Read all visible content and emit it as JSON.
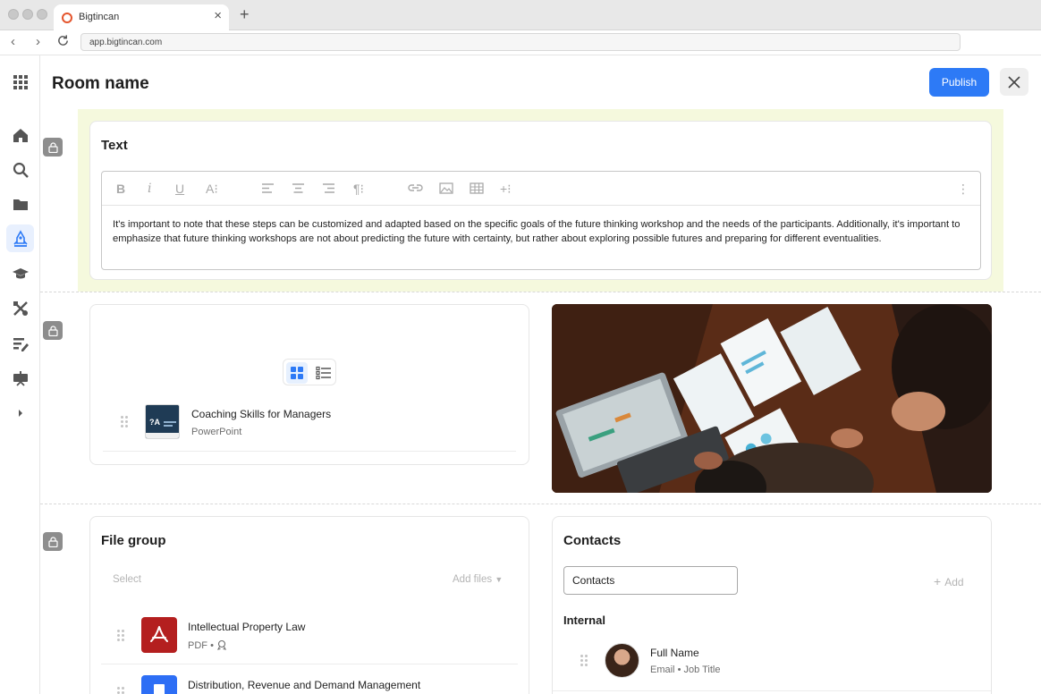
{
  "browser": {
    "tab_title": "Bigtincan",
    "url": "app.bigtincan.com"
  },
  "header": {
    "title": "Room name",
    "publish_label": "Publish"
  },
  "text_block": {
    "title": "Text",
    "content": "It's important to note that these steps can be customized and adapted based on the specific goals of the future thinking workshop and the needs of the participants. Additionally, it's important to emphasize that future thinking workshops are not about predicting the future with certainty, but rather about exploring possible futures and preparing for different eventualities."
  },
  "files_block": {
    "items": [
      {
        "title": "Coaching Skills for Managers",
        "type": "PowerPoint"
      }
    ]
  },
  "file_group": {
    "title": "File group",
    "select_label": "Select",
    "add_files_label": "Add files",
    "items": [
      {
        "title": "Intellectual Property Law",
        "type": "PDF"
      },
      {
        "title": "Distribution, Revenue and Demand Management"
      }
    ]
  },
  "contacts": {
    "title": "Contacts",
    "input_value": "Contacts",
    "add_label": "Add",
    "section_label": "Internal",
    "people": [
      {
        "name": "Full Name",
        "email_label": "Email",
        "job_label": "Job Title"
      }
    ]
  },
  "colors": {
    "accent": "#2d7af6",
    "highlight": "#f5f9dd",
    "pdf": "#b41f1f",
    "doc": "#2d6ef5"
  }
}
